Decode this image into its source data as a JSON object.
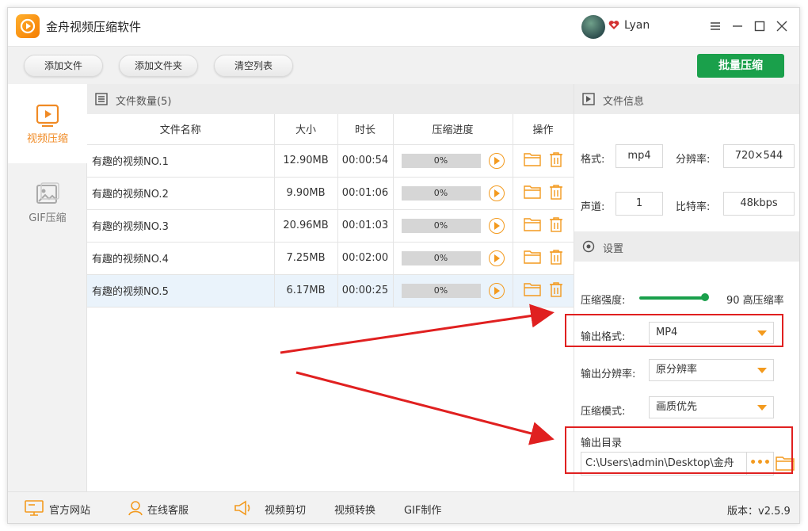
{
  "app": {
    "title": "金舟视频压缩软件"
  },
  "user": {
    "name": "Lyan"
  },
  "toolbar": {
    "add_file": "添加文件",
    "add_folder": "添加文件夹",
    "clear_list": "清空列表",
    "batch_compress": "批量压缩"
  },
  "sidebar": {
    "items": [
      {
        "label": "视频压缩",
        "icon": "video-compress-icon",
        "active": true
      },
      {
        "label": "GIF压缩",
        "icon": "gif-compress-icon",
        "active": false
      }
    ]
  },
  "filelist": {
    "header": "文件数量(5)",
    "columns": [
      "文件名称",
      "大小",
      "时长",
      "压缩进度",
      "操作"
    ],
    "rows": [
      {
        "name": "有趣的视频NO.1",
        "size": "12.90MB",
        "duration": "00:00:54",
        "progress": "0%"
      },
      {
        "name": "有趣的视频NO.2",
        "size": "9.90MB",
        "duration": "00:01:06",
        "progress": "0%"
      },
      {
        "name": "有趣的视频NO.3",
        "size": "20.96MB",
        "duration": "00:01:03",
        "progress": "0%"
      },
      {
        "name": "有趣的视频NO.4",
        "size": "7.25MB",
        "duration": "00:02:00",
        "progress": "0%"
      },
      {
        "name": "有趣的视频NO.5",
        "size": "6.17MB",
        "duration": "00:00:25",
        "progress": "0%"
      }
    ]
  },
  "fileinfo": {
    "header": "文件信息",
    "format_label": "格式:",
    "format": "mp4",
    "resolution_label": "分辨率:",
    "resolution": "720×544",
    "channel_label": "声道:",
    "channel": "1",
    "bitrate_label": "比特率:",
    "bitrate": "48kbps"
  },
  "settings": {
    "header": "设置",
    "strength_label": "压缩强度:",
    "strength_value": "90 高压缩率",
    "strength_level": 90,
    "output_format_label": "输出格式:",
    "output_format": "MP4",
    "output_resolution_label": "输出分辨率:",
    "output_resolution": "原分辨率",
    "compress_mode_label": "压缩模式:",
    "compress_mode": "画质优先",
    "output_dir_label": "输出目录",
    "output_dir": "C:\\Users\\admin\\Desktop\\金舟",
    "browse": "•••"
  },
  "footer": {
    "website": "官方网站",
    "support": "在线客服",
    "video_cut": "视频剪切",
    "video_convert": "视频转换",
    "gif_make": "GIF制作",
    "version": "版本：v2.5.9"
  },
  "colors": {
    "accent": "#f39a1e",
    "primary": "#1aa04b",
    "highlight": "#e02020"
  }
}
